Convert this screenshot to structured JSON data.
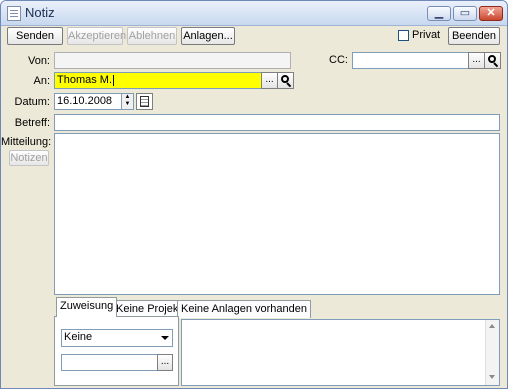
{
  "window": {
    "title": "Notiz"
  },
  "toolbar": {
    "send_label": "Senden",
    "accept_label": "Akzeptieren",
    "decline_label": "Ablehnen",
    "attachments_label": "Anlagen...",
    "private_label": "Privat",
    "private_checked": false,
    "close_label": "Beenden"
  },
  "form": {
    "from_label": "Von:",
    "from_value": "",
    "to_label": "An:",
    "to_value": "Thomas M.",
    "cc_label": "CC:",
    "cc_value": "",
    "date_label": "Datum:",
    "date_value": "16.10.2008",
    "subject_label": "Betreff:",
    "subject_value": "",
    "message_label": "Mitteilung:",
    "notes_button_label": "Notizen",
    "browse_label": "..."
  },
  "tabs": [
    {
      "label": "Zuweisung",
      "active": true
    },
    {
      "label": "Keine Projekte",
      "active": false
    },
    {
      "label": "Keine Anlagen vorhanden",
      "active": false
    }
  ],
  "assignment": {
    "select_value": "Keine",
    "text_value": ""
  },
  "icons": {
    "title": "note-icon",
    "search": "magnifier-icon",
    "calendar": "calendar-icon"
  }
}
